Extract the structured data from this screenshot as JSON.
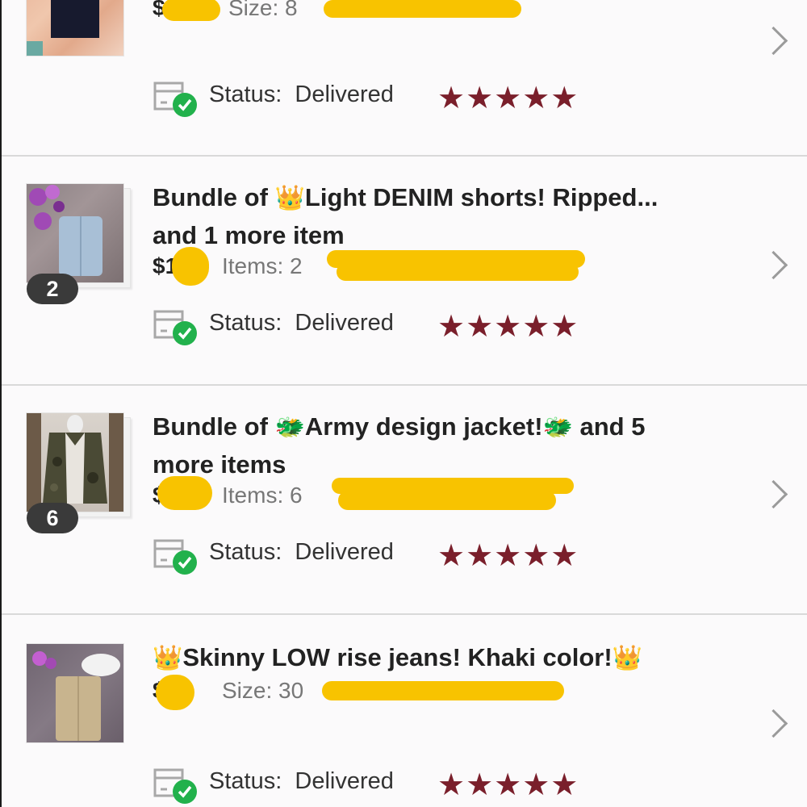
{
  "colors": {
    "star": "#7a1f2b",
    "redaction": "#f8c300",
    "status_check": "#22b14c",
    "badge_bg": "#3a3a3a"
  },
  "orders": [
    {
      "title": "",
      "price": "$",
      "meta": "Size: 8",
      "count": "",
      "status_label": "Status:",
      "status_value": "Delivered",
      "stars": "★★★★★",
      "thumb": "dark-jeans"
    },
    {
      "title_emoji": "👑",
      "title_line1_pre": "Bundle of ",
      "title_line1_post": "Light DENIM shorts! Ripped...",
      "title_line2": "and 1 more item",
      "price": "$1",
      "meta": "Items: 2",
      "count": "2",
      "status_label": "Status:",
      "status_value": "Delivered",
      "stars": "★★★★★",
      "thumb": "denim-shorts"
    },
    {
      "title_emoji": "🐲",
      "title_line1_pre": "Bundle of ",
      "title_line1_mid": "Army design jacket!",
      "title_line1_post": " and 5",
      "title_line2": "more items",
      "price": "$",
      "meta": "Items: 6",
      "count": "6",
      "status_label": "Status:",
      "status_value": "Delivered",
      "stars": "★★★★★",
      "thumb": "army-jacket"
    },
    {
      "title_emoji": "👑",
      "title_line1_mid": "Skinny LOW rise jeans! Khaki color!",
      "price": "$",
      "meta": "Size: 30",
      "count": "",
      "status_label": "Status:",
      "status_value": "Delivered",
      "stars": "★★★★★",
      "thumb": "khaki-jeans"
    }
  ]
}
